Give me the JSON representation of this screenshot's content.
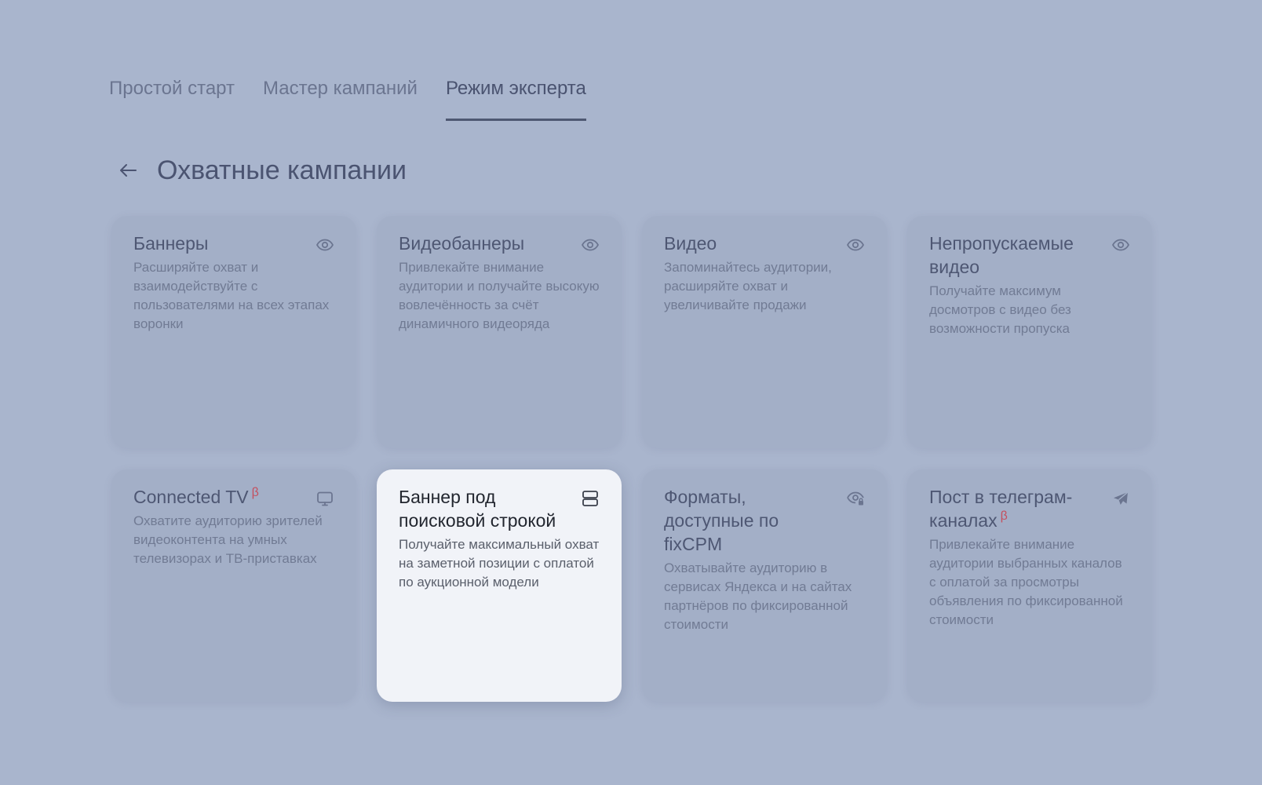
{
  "tabs": [
    {
      "label": "Простой старт",
      "active": false
    },
    {
      "label": "Мастер кампаний",
      "active": false
    },
    {
      "label": "Режим эксперта",
      "active": true
    }
  ],
  "page": {
    "back_icon": "arrow-left-icon",
    "title": "Охватные кампании"
  },
  "colors": {
    "background": "#a9b5cd",
    "beta_accent": "#c4505f"
  },
  "cards": [
    {
      "title": "Баннеры",
      "desc": "Расширяйте охват и взаимодействуйте с пользователями на всех этапах воронки",
      "icon": "eye-icon"
    },
    {
      "title": "Видеобаннеры",
      "desc": "Привлекайте внимание аудитории и получайте высокую вовлечённость за счёт динамичного видеоряда",
      "icon": "eye-icon"
    },
    {
      "title": "Видео",
      "desc": "Запоминайтесь аудитории, расширяйте охват и увеличивайте продажи",
      "icon": "eye-icon"
    },
    {
      "title": "Непропускаемые видео",
      "desc": "Получайте максимум досмотров с видео без возможности пропуска",
      "icon": "eye-icon"
    },
    {
      "title": "Connected TV",
      "beta": "β",
      "desc": "Охватите аудиторию зрителей видеоконтента на умных телевизорах и ТВ-приставках",
      "icon": "tv-icon"
    },
    {
      "title": "Баннер под поисковой строкой",
      "desc": "Получайте максимальный охват на заметной позиции с оплатой по аукционной модели",
      "icon": "search-banner-icon",
      "highlighted": true
    },
    {
      "title": "Форматы, доступные по fixCPM",
      "desc": "Охватывайте аудиторию в сервисах Яндекса и на сайтах партнёров по фиксированной стоимости",
      "icon": "eye-lock-icon"
    },
    {
      "title": "Пост в телеграм-каналах",
      "beta": "β",
      "desc": "Привлекайте внимание аудитории выбранных каналов с оплатой за просмотры объявления по фиксированной стоимости",
      "icon": "telegram-icon"
    }
  ]
}
